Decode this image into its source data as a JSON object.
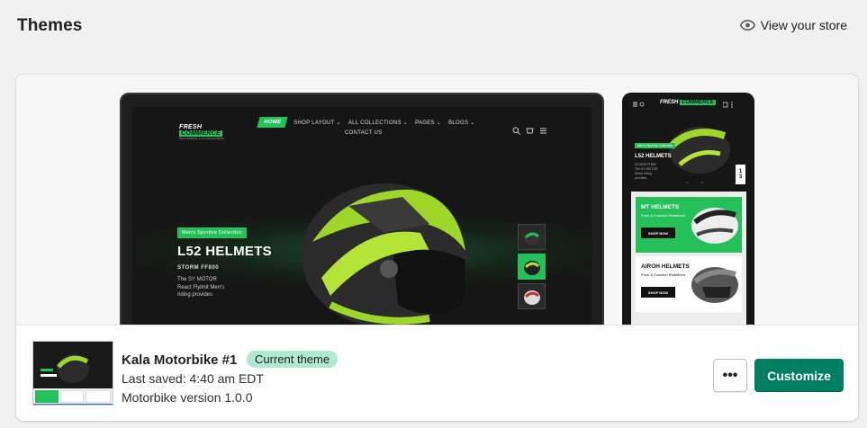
{
  "page": {
    "title": "Themes",
    "view_store_label": "View your store"
  },
  "preview": {
    "laptop": {
      "logo_line1_a": "FRESH",
      "logo_line1_b": "COMMERCE",
      "logo_line2": "MOTORBIKE & ACCESSORIES",
      "nav": [
        "HOME",
        "SHOP LAYOUT ⌄",
        "ALL COLLECTIONS ⌄",
        "PAGES ⌄",
        "BLOGS ⌄"
      ],
      "nav_second_row": "CONTACT US",
      "cart_count": "0",
      "hero_tag": "Men's Sportive Collection",
      "hero_heading": "L52 HELMETS",
      "hero_sub": "STORM FF800",
      "hero_desc": "The SY MOTOR React Flylmit Men's riding provides"
    },
    "phone": {
      "logo_a": "FRESH",
      "logo_b": "COMMERCE",
      "hero_tag": "Men's Sportive Collection",
      "hero_heading": "L52 HELMETS",
      "hero_sub": "STORM FF800 The SY MOTOR React riding provides",
      "pager_1": "1",
      "pager_2": "3",
      "arrows": "← →",
      "card1_title": "MT HELMETS",
      "card1_desc": "Form & Function Redefined",
      "card1_btn": "SHOP NOW",
      "card2_title": "AIROH HELMETS",
      "card2_desc": "Form & Function Redefined",
      "card2_btn": "SHOP NOW"
    }
  },
  "theme": {
    "name": "Kala Motorbike #1",
    "badge": "Current theme",
    "last_saved": "Last saved: 4:40 am EDT",
    "version": "Motorbike version 1.0.0",
    "more_label": "•••",
    "customize_label": "Customize"
  },
  "colors": {
    "primary": "#008060",
    "badge_bg": "#aee9d1",
    "theme_accent": "#24c05a"
  }
}
